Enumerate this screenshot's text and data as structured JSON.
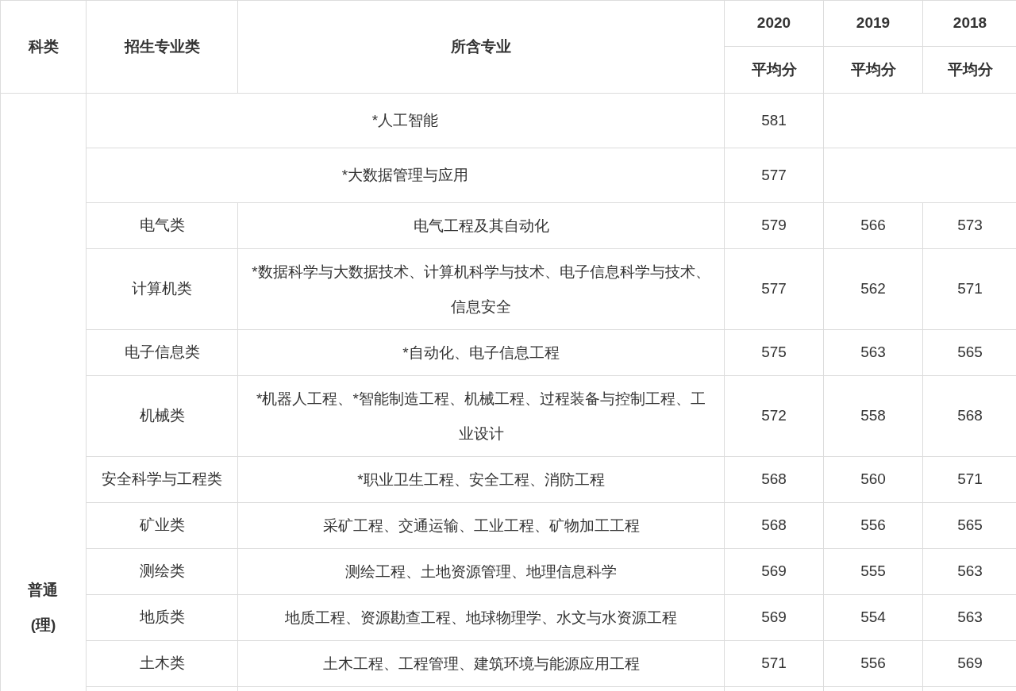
{
  "table": {
    "columns": [
      {
        "label": "科类"
      },
      {
        "label": "招生专业类"
      },
      {
        "label": "所含专业"
      }
    ],
    "years": [
      {
        "year": "2020",
        "label": "平均分"
      },
      {
        "year": "2019",
        "label": "平均分"
      },
      {
        "year": "2018",
        "label": "平均分"
      }
    ],
    "group": "普通(理)",
    "rows": [
      {
        "kind": "merged",
        "major": "*人工智能",
        "scores": [
          "581"
        ]
      },
      {
        "kind": "merged",
        "major": "*大数据管理与应用",
        "scores": [
          "577"
        ]
      },
      {
        "kind": "normal",
        "category": "电气类",
        "major": "电气工程及其自动化",
        "scores": [
          "579",
          "566",
          "573"
        ]
      },
      {
        "kind": "normal",
        "category": "计算机类",
        "major": "*数据科学与大数据技术、计算机科学与技术、电子信息科学与技术、信息安全",
        "scores": [
          "577",
          "562",
          "571"
        ]
      },
      {
        "kind": "normal",
        "category": "电子信息类",
        "major": "*自动化、电子信息工程",
        "scores": [
          "575",
          "563",
          "565"
        ]
      },
      {
        "kind": "normal",
        "category": "机械类",
        "major": "*机器人工程、*智能制造工程、机械工程、过程装备与控制工程、工业设计",
        "scores": [
          "572",
          "558",
          "568"
        ]
      },
      {
        "kind": "normal",
        "category": "安全科学与工程类",
        "major": "*职业卫生工程、安全工程、消防工程",
        "scores": [
          "568",
          "560",
          "571"
        ]
      },
      {
        "kind": "normal",
        "category": "矿业类",
        "major": "采矿工程、交通运输、工业工程、矿物加工工程",
        "scores": [
          "568",
          "556",
          "565"
        ]
      },
      {
        "kind": "normal",
        "category": "测绘类",
        "major": "测绘工程、土地资源管理、地理信息科学",
        "scores": [
          "569",
          "555",
          "563"
        ]
      },
      {
        "kind": "normal",
        "category": "地质类",
        "major": "地质工程、资源勘查工程、地球物理学、水文与水资源工程",
        "scores": [
          "569",
          "554",
          "563"
        ]
      },
      {
        "kind": "normal",
        "category": "土木类",
        "major": "土木工程、工程管理、建筑环境与能源应用工程",
        "scores": [
          "571",
          "556",
          "569"
        ]
      }
    ]
  }
}
